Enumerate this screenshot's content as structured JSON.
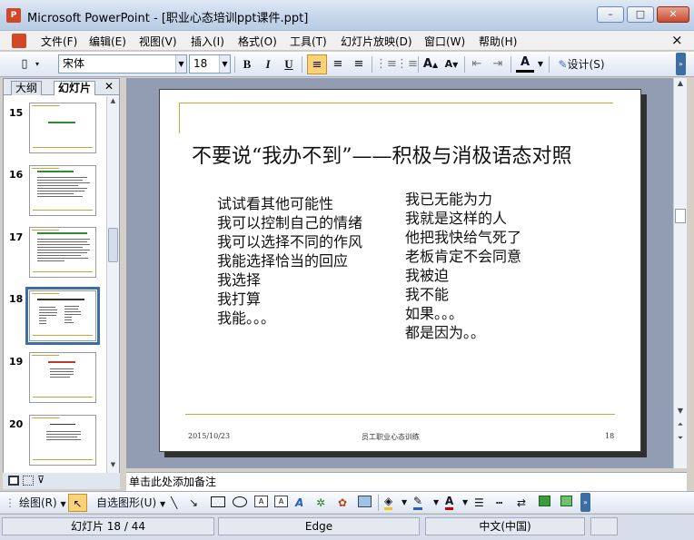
{
  "window": {
    "title": "Microsoft PowerPoint - [职业心态培训ppt课件.ppt]",
    "min": "–",
    "max": "□",
    "close": "✕"
  },
  "menu": {
    "items": [
      "文件(F)",
      "编辑(E)",
      "视图(V)",
      "插入(I)",
      "格式(O)",
      "工具(T)",
      "幻灯片放映(D)",
      "窗口(W)",
      "帮助(H)"
    ],
    "close": "×"
  },
  "toolbar": {
    "font": "宋体",
    "size": "18",
    "bold": "B",
    "italic": "I",
    "underline": "U",
    "design": "设计(S)",
    "font_color": "A"
  },
  "left_pane": {
    "tab_outline": "大纲",
    "tab_slides": "幻灯片",
    "close": "✕",
    "slides": [
      {
        "num": "15"
      },
      {
        "num": "16"
      },
      {
        "num": "17"
      },
      {
        "num": "18"
      },
      {
        "num": "19"
      },
      {
        "num": "20"
      }
    ]
  },
  "slide": {
    "title": "不要说“我办不到”——积极与消极语态对照",
    "left_col": [
      "试试看其他可能性",
      "我可以控制自己的情绪",
      "我可以选择不同的作风",
      "我能选择恰当的回应",
      "我选择",
      "我打算",
      "我能。。。"
    ],
    "right_col": [
      "我已无能为力",
      "我就是这样的人",
      "他把我快给气死了",
      "老板肯定不会同意",
      "我被迫",
      "我不能",
      "如果。。。",
      "都是因为。。"
    ],
    "footer_date": "2015/10/23",
    "footer_center": "员工职业心态训练",
    "footer_page": "18"
  },
  "notes": {
    "placeholder": "单击此处添加备注"
  },
  "drawbar": {
    "draw": "绘图(R)",
    "autoshapes": "自选图形(U)"
  },
  "status": {
    "slide": "幻灯片 18 / 44",
    "design": "Edge",
    "language": "中文(中国)"
  },
  "colors": {
    "accent_gold": "#c9a63b",
    "selected_thumb": "#3a6ea5",
    "workspace": "#929db4"
  }
}
